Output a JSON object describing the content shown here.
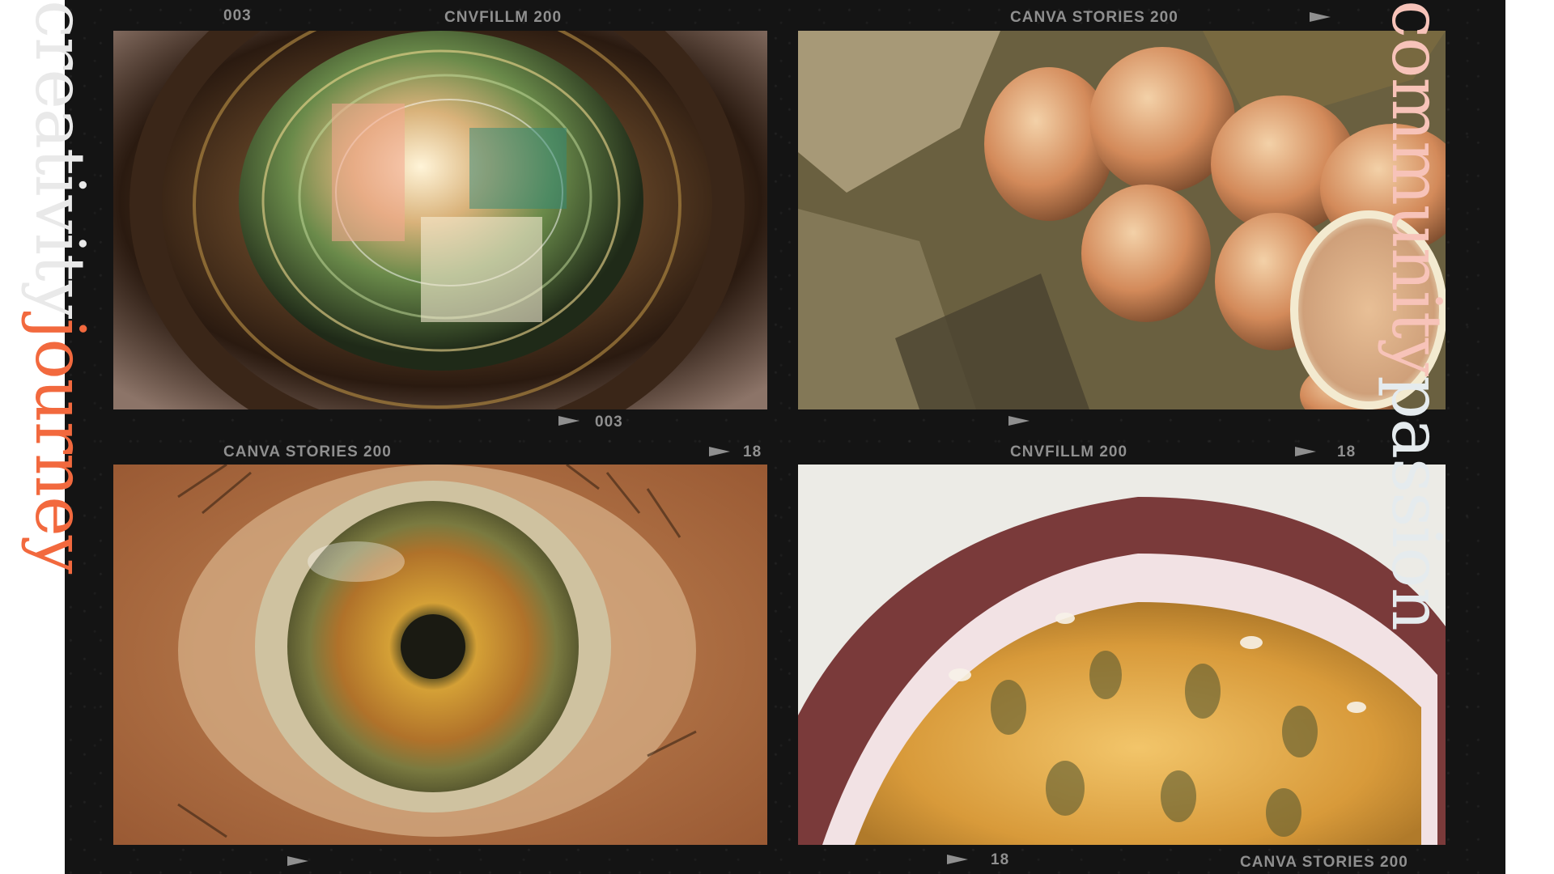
{
  "labels": {
    "top_left_number": "003",
    "top_left_film": "CNVFILLM 200",
    "top_right_film": "CANVA STORIES 200",
    "middle_left_number": "003",
    "middle_left_film": "CANVA STORIES 200",
    "middle_left_count": "18",
    "middle_right_film": "CNVFILLM 200",
    "middle_right_count": "18",
    "bottom_right_count": "18",
    "bottom_right_film": "CANVA STORIES 200"
  },
  "vertical_text": {
    "left_word_1": "creativity",
    "left_word_2": "journey",
    "right_word_1": "community",
    "right_word_2": "passion"
  },
  "colors": {
    "film_background": "#141414",
    "label_gray": "#8f8f8f",
    "word_light": "#e9e9e9",
    "word_orange": "#f2693e",
    "word_pink": "#f7c3b9",
    "word_pale": "#e5ebee"
  }
}
